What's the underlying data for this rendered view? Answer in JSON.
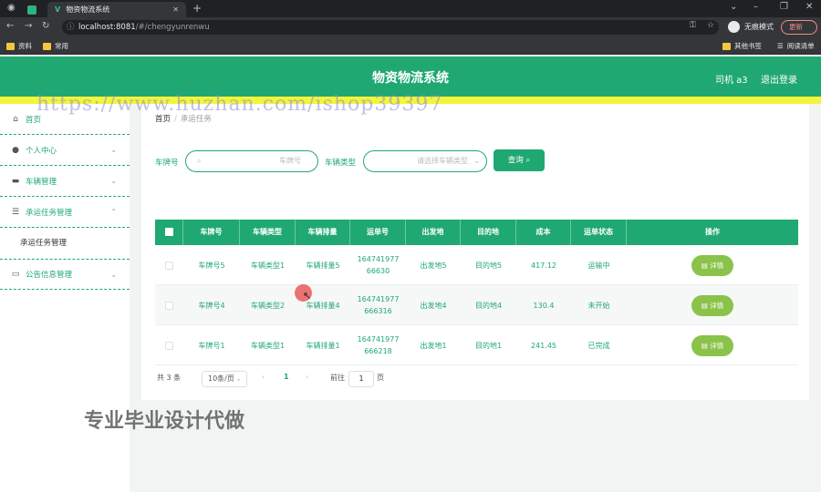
{
  "browser": {
    "tab_title": "物资物流系统",
    "url_host": "localhost:8081",
    "url_path": "/#/chengyunrenwu",
    "incognito_label": "无痕模式",
    "update_label": "更新",
    "bookmarks": [
      "资料",
      "常用"
    ],
    "bookmarks_right": [
      "其他书签",
      "阅读清单"
    ]
  },
  "header": {
    "title": "物资物流系统",
    "user": "司机 a3",
    "logout": "退出登录"
  },
  "sidebar": {
    "items": [
      {
        "label": "首页",
        "icon": "home-icon"
      },
      {
        "label": "个人中心",
        "icon": "user-icon"
      },
      {
        "label": "车辆管理",
        "icon": "monitor-icon"
      },
      {
        "label": "承运任务管理",
        "icon": "list-icon"
      },
      {
        "label": "承运任务管理",
        "icon": ""
      },
      {
        "label": "公告信息管理",
        "icon": "chat-icon"
      }
    ]
  },
  "breadcrumb": {
    "home": "首页",
    "current": "承运任务"
  },
  "search": {
    "plate_label": "车牌号",
    "plate_placeholder": "车牌号",
    "type_label": "车辆类型",
    "type_placeholder": "请选择车辆类型",
    "button": "查询"
  },
  "table": {
    "headers": [
      "车牌号",
      "车辆类型",
      "车辆排量",
      "运单号",
      "出发地",
      "目的地",
      "成本",
      "运单状态",
      "操作"
    ],
    "rows": [
      {
        "plate": "车牌号5",
        "type": "车辆类型1",
        "displacement": "车辆排量5",
        "waybill_1": "164741977",
        "waybill_2": "66630",
        "from": "出发地5",
        "to": "目的地5",
        "cost": "417.12",
        "status": "运输中",
        "action": "详情"
      },
      {
        "plate": "车牌号4",
        "type": "车辆类型2",
        "displacement": "车辆排量4",
        "waybill_1": "164741977",
        "waybill_2": "666316",
        "from": "出发地4",
        "to": "目的地4",
        "cost": "130.4",
        "status": "未开始",
        "action": "详情"
      },
      {
        "plate": "车牌号1",
        "type": "车辆类型1",
        "displacement": "车辆排量1",
        "waybill_1": "164741977",
        "waybill_2": "666218",
        "from": "出发地1",
        "to": "目的地1",
        "cost": "241.45",
        "status": "已完成",
        "action": "详情"
      }
    ]
  },
  "pagination": {
    "total": "共 3 条",
    "page_size": "10条/页",
    "prev": "‹",
    "current": "1",
    "next": "›",
    "goto": "前往",
    "goto_value": "1",
    "page_unit": "页"
  },
  "watermarks": {
    "url": "https://www.huzhan.com/ishop39397",
    "promo": "专业毕业设计代做"
  }
}
